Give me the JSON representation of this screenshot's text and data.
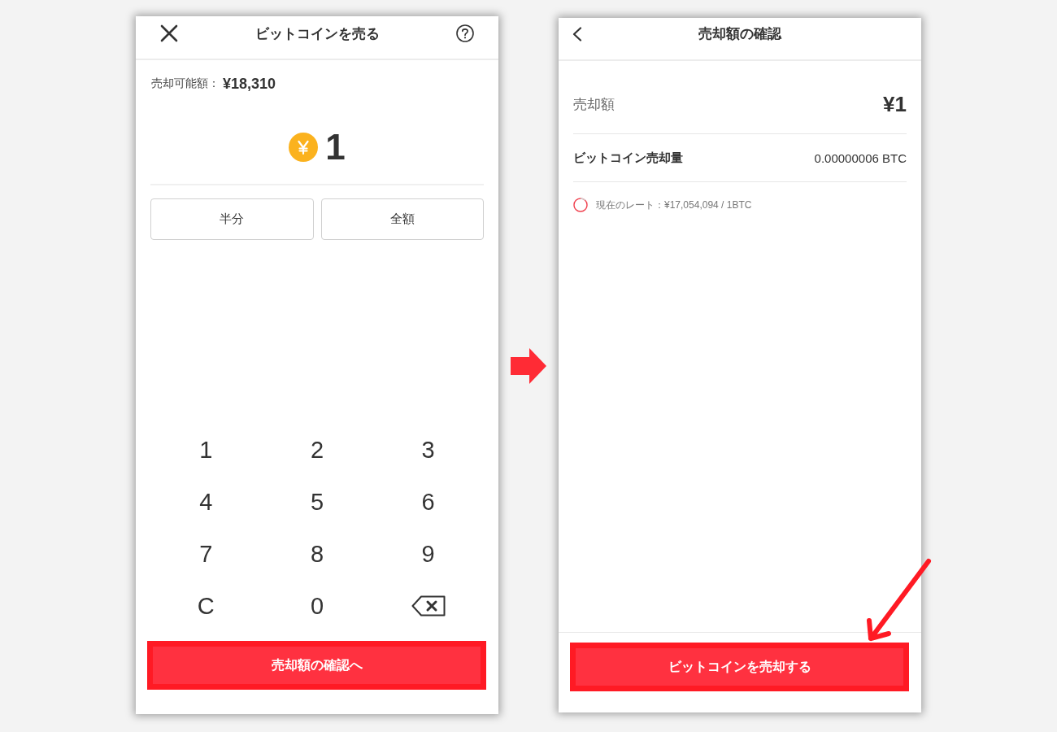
{
  "sell_screen": {
    "title": "ビットコインを売る",
    "available": {
      "label": "売却可能額：",
      "value": "¥18,310"
    },
    "amount": "1",
    "quick_buttons": [
      "半分",
      "全額"
    ],
    "keypad": [
      {
        "kind": "key",
        "label": "1"
      },
      {
        "kind": "key",
        "label": "2"
      },
      {
        "kind": "key",
        "label": "3"
      },
      {
        "kind": "key",
        "label": "4"
      },
      {
        "kind": "key",
        "label": "5"
      },
      {
        "kind": "key",
        "label": "6"
      },
      {
        "kind": "key",
        "label": "7"
      },
      {
        "kind": "key",
        "label": "8"
      },
      {
        "kind": "key",
        "label": "9"
      },
      {
        "kind": "key",
        "label": "C"
      },
      {
        "kind": "key",
        "label": "0"
      },
      {
        "kind": "backspace"
      }
    ],
    "primary_button": {
      "label": "売却額の確認へ",
      "highlighted": true
    }
  },
  "confirm_screen": {
    "title": "売却額の確認",
    "rows": [
      {
        "kind": "total",
        "label": "売却額",
        "value": "¥1"
      },
      {
        "kind": "detail",
        "label": "ビットコイン売却量",
        "value": "0.00000006 BTC"
      }
    ],
    "rate": "現在のレート：¥17,054,094 / 1BTC",
    "primary_button": {
      "label": "ビットコインを売却する",
      "highlighted": true
    }
  }
}
